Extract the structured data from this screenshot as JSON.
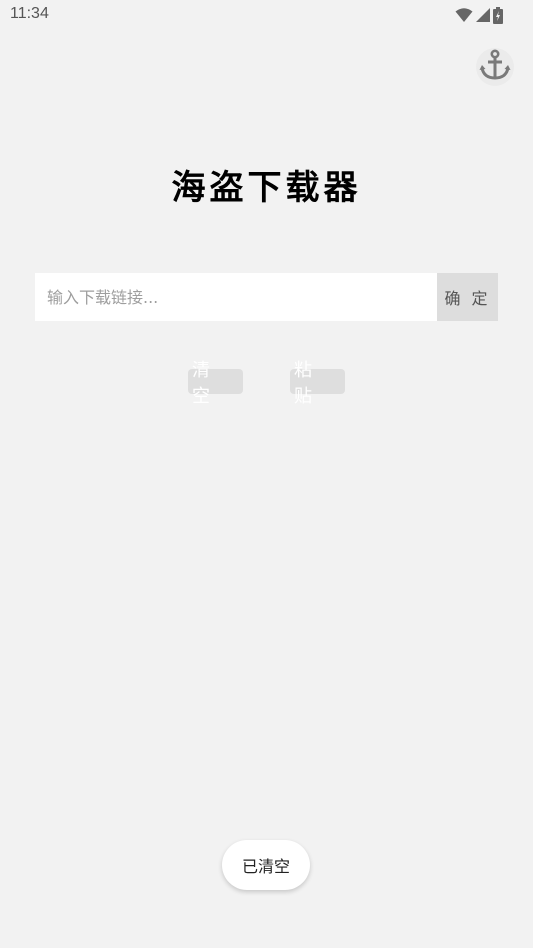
{
  "status_bar": {
    "time": "11:34",
    "icons": [
      "wifi-icon",
      "signal-icon",
      "battery-icon"
    ]
  },
  "header": {
    "anchor_icon": "anchor-icon",
    "title": "海盗下载器"
  },
  "download_form": {
    "url_placeholder": "输入下载链接...",
    "url_value": "",
    "confirm_label": "确 定"
  },
  "actions": {
    "clear_label": "清 空",
    "paste_label": "粘 贴"
  },
  "toast": {
    "message": "已清空"
  },
  "colors": {
    "background": "#f2f2f2",
    "input_background": "#ffffff",
    "confirm_background": "#dddddd",
    "action_button_background": "#dedede",
    "title_color": "#000000"
  }
}
